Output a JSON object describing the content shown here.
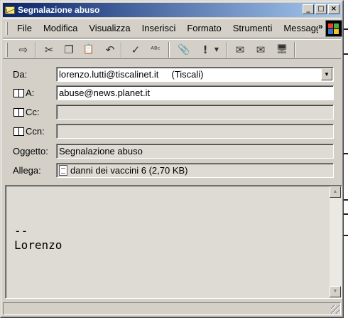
{
  "window": {
    "title": "Segnalazione abuso"
  },
  "title_buttons": {
    "minimize": "_",
    "maximize": "□",
    "close": "×"
  },
  "menu": {
    "items": [
      "File",
      "Modifica",
      "Visualizza",
      "Inserisci",
      "Formato",
      "Strumenti",
      "Messaggio"
    ],
    "overflow": "»"
  },
  "toolbar": {
    "icons": [
      "send-icon",
      "cut-icon",
      "copy-icon",
      "paste-icon",
      "undo-icon",
      "check-names-icon",
      "spelling-icon",
      "attach-icon",
      "priority-icon",
      "sign-icon",
      "encrypt-icon",
      "offline-icon"
    ],
    "glyphs": {
      "send": "⇨",
      "cut": "✂",
      "copy": "❐",
      "paste": "📋",
      "undo": "↶",
      "check": "✓",
      "spell": "ᴬᴮᶜ",
      "attach": "📎",
      "priority": "!",
      "sign": "✉",
      "encrypt": "✉",
      "offline": "🖥"
    }
  },
  "headers": {
    "from": {
      "label": "Da:",
      "value": "lorenzo.lutti@tiscalinet.it     (Tiscali)"
    },
    "to": {
      "label": "A:",
      "value": "abuse@news.planet.it"
    },
    "cc": {
      "label": "Cc:",
      "value": ""
    },
    "bcc": {
      "label": "Ccn:",
      "value": ""
    },
    "subject": {
      "label": "Oggetto:",
      "value": "Segnalazione abuso"
    },
    "attach": {
      "label": "Allega:",
      "value": "danni dei vaccini 6 (2,70 KB)"
    }
  },
  "body": {
    "text": "--\nLorenzo"
  },
  "colors": {
    "title_bar_start": "#0a246a",
    "title_bar_end": "#a6caf0",
    "face": "#d4d0c8"
  }
}
